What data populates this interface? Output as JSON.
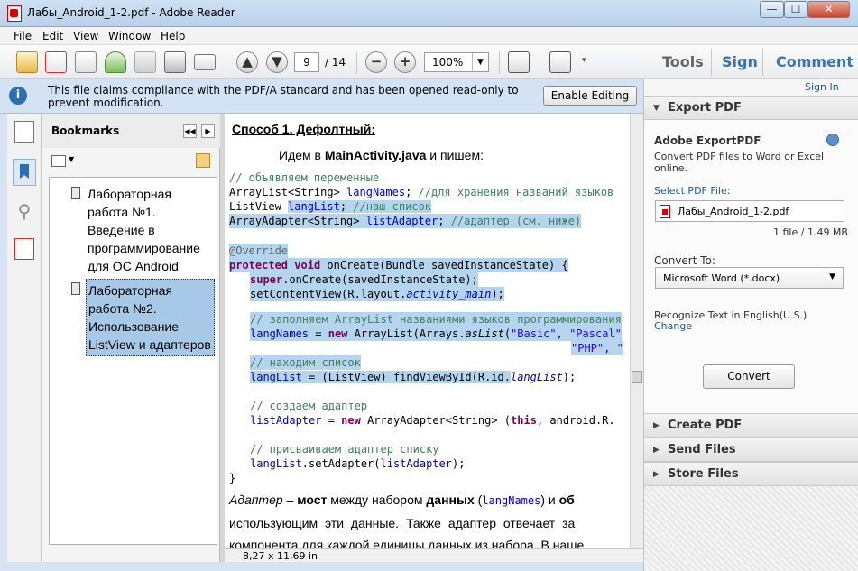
{
  "window": {
    "title": "Лабы_Android_1-2.pdf - Adobe Reader",
    "min": "—",
    "max": "☐",
    "close": "✕"
  },
  "menu": [
    "File",
    "Edit",
    "View",
    "Window",
    "Help"
  ],
  "toolbar": {
    "page_current": "9",
    "page_total": "/ 14",
    "zoom": "100%",
    "links": {
      "tools": "Tools",
      "sign": "Sign",
      "comment": "Comment"
    }
  },
  "notice": {
    "message": "This file claims compliance with the PDF/A standard and has been opened read-only to prevent modification.",
    "enable_label": "Enable Editing"
  },
  "bookmarks": {
    "title": "Bookmarks",
    "items": [
      {
        "label": "Лабораторная работа №1. Введение в программирование для ОС Android"
      },
      {
        "label": "Лабораторная работа №2. Использование ListView и адаптеров"
      }
    ]
  },
  "document": {
    "heading": "Способ 1. Дефолтный:",
    "intro_pre": "Идем в ",
    "intro_bold": "MainActivity.java",
    "intro_post": " и пишем:",
    "para1_a": "Адаптер",
    "para1_b": " – ",
    "para1_c": "мост",
    "para1_d": " между набором ",
    "para1_e": "данных",
    "para1_f": " (",
    "para1_g": "langNames",
    "para1_h": ") и ",
    "para1_i": "об",
    "para2": "использующим эти данные. Также адаптер отвечает за",
    "para3": "компонента для каждой единицы данных из набора. В наше",
    "page_size": "8,27 x 11,69 in"
  },
  "code": {
    "l1": "// объявляем переменные",
    "l2a": "ArrayList<String> ",
    "l2b": "langNames",
    "l2c": "; ",
    "l2d": "//для хранения названий языков",
    "l3a": "ListView ",
    "l3b": "langList",
    "l3c": "; ",
    "l3d": "//наш список",
    "l4a": "ArrayAdapter<String> ",
    "l4b": "listAdapter",
    "l4c": "; ",
    "l4d": "//адаптер (см. ниже)",
    "l5": "@Override",
    "l6a": "protected",
    "l6b": " ",
    "l6c": "void",
    "l6d": " onCreate(Bundle savedInstanceState) {",
    "l7a": "super",
    "l7b": ".onCreate(savedInstanceState);",
    "l8a": "setContentView(R.layout.",
    "l8b": "activity_main",
    "l8c": ");",
    "l9": "// заполняем ArrayList названиями языков программирования",
    "l10a": "langNames",
    "l10b": " = ",
    "l10c": "new",
    "l10d": " ArrayList(Arrays.",
    "l10e": "asList",
    "l10f": "(",
    "l10g": "\"Basic\"",
    "l10h": ", ",
    "l10i": "\"Pascal\"",
    "l11a": "\"PHP\"",
    "l11b": ", \"",
    "l12": "// находим список",
    "l13a": "langList",
    "l13b": " = (ListView) findViewById(R.id.",
    "l13c": "langList",
    "l13d": ");",
    "l14": "// создаем адаптер",
    "l15a": "listAdapter",
    "l15b": " = ",
    "l15c": "new",
    "l15d": " ArrayAdapter<String> (",
    "l15e": "this",
    "l15f": ", android.R.",
    "l16": "// присваиваем адаптер списку",
    "l17a": "langList",
    "l17b": ".setAdapter(",
    "l17c": "listAdapter",
    "l17d": ");",
    "l18": "}"
  },
  "right_pane": {
    "sign_in": "Sign In",
    "export_title": "Export PDF",
    "export_heading": "Adobe ExportPDF",
    "export_desc": "Convert PDF files to Word or Excel online.",
    "select_label": "Select PDF File:",
    "file_name": "Лабы_Android_1-2.pdf",
    "file_info": "1 file / 1.49 MB",
    "convert_to_label": "Convert To:",
    "convert_to_value": "Microsoft Word (*.docx)",
    "recognize": "Recognize Text in English(U.S.)",
    "change": "Change",
    "convert_button": "Convert",
    "sections": [
      "Create PDF",
      "Send Files",
      "Store Files"
    ]
  },
  "colors": {
    "accent": "#3e72b0",
    "highlight": "#b5d5ef",
    "selection": "#a7c9e7"
  }
}
